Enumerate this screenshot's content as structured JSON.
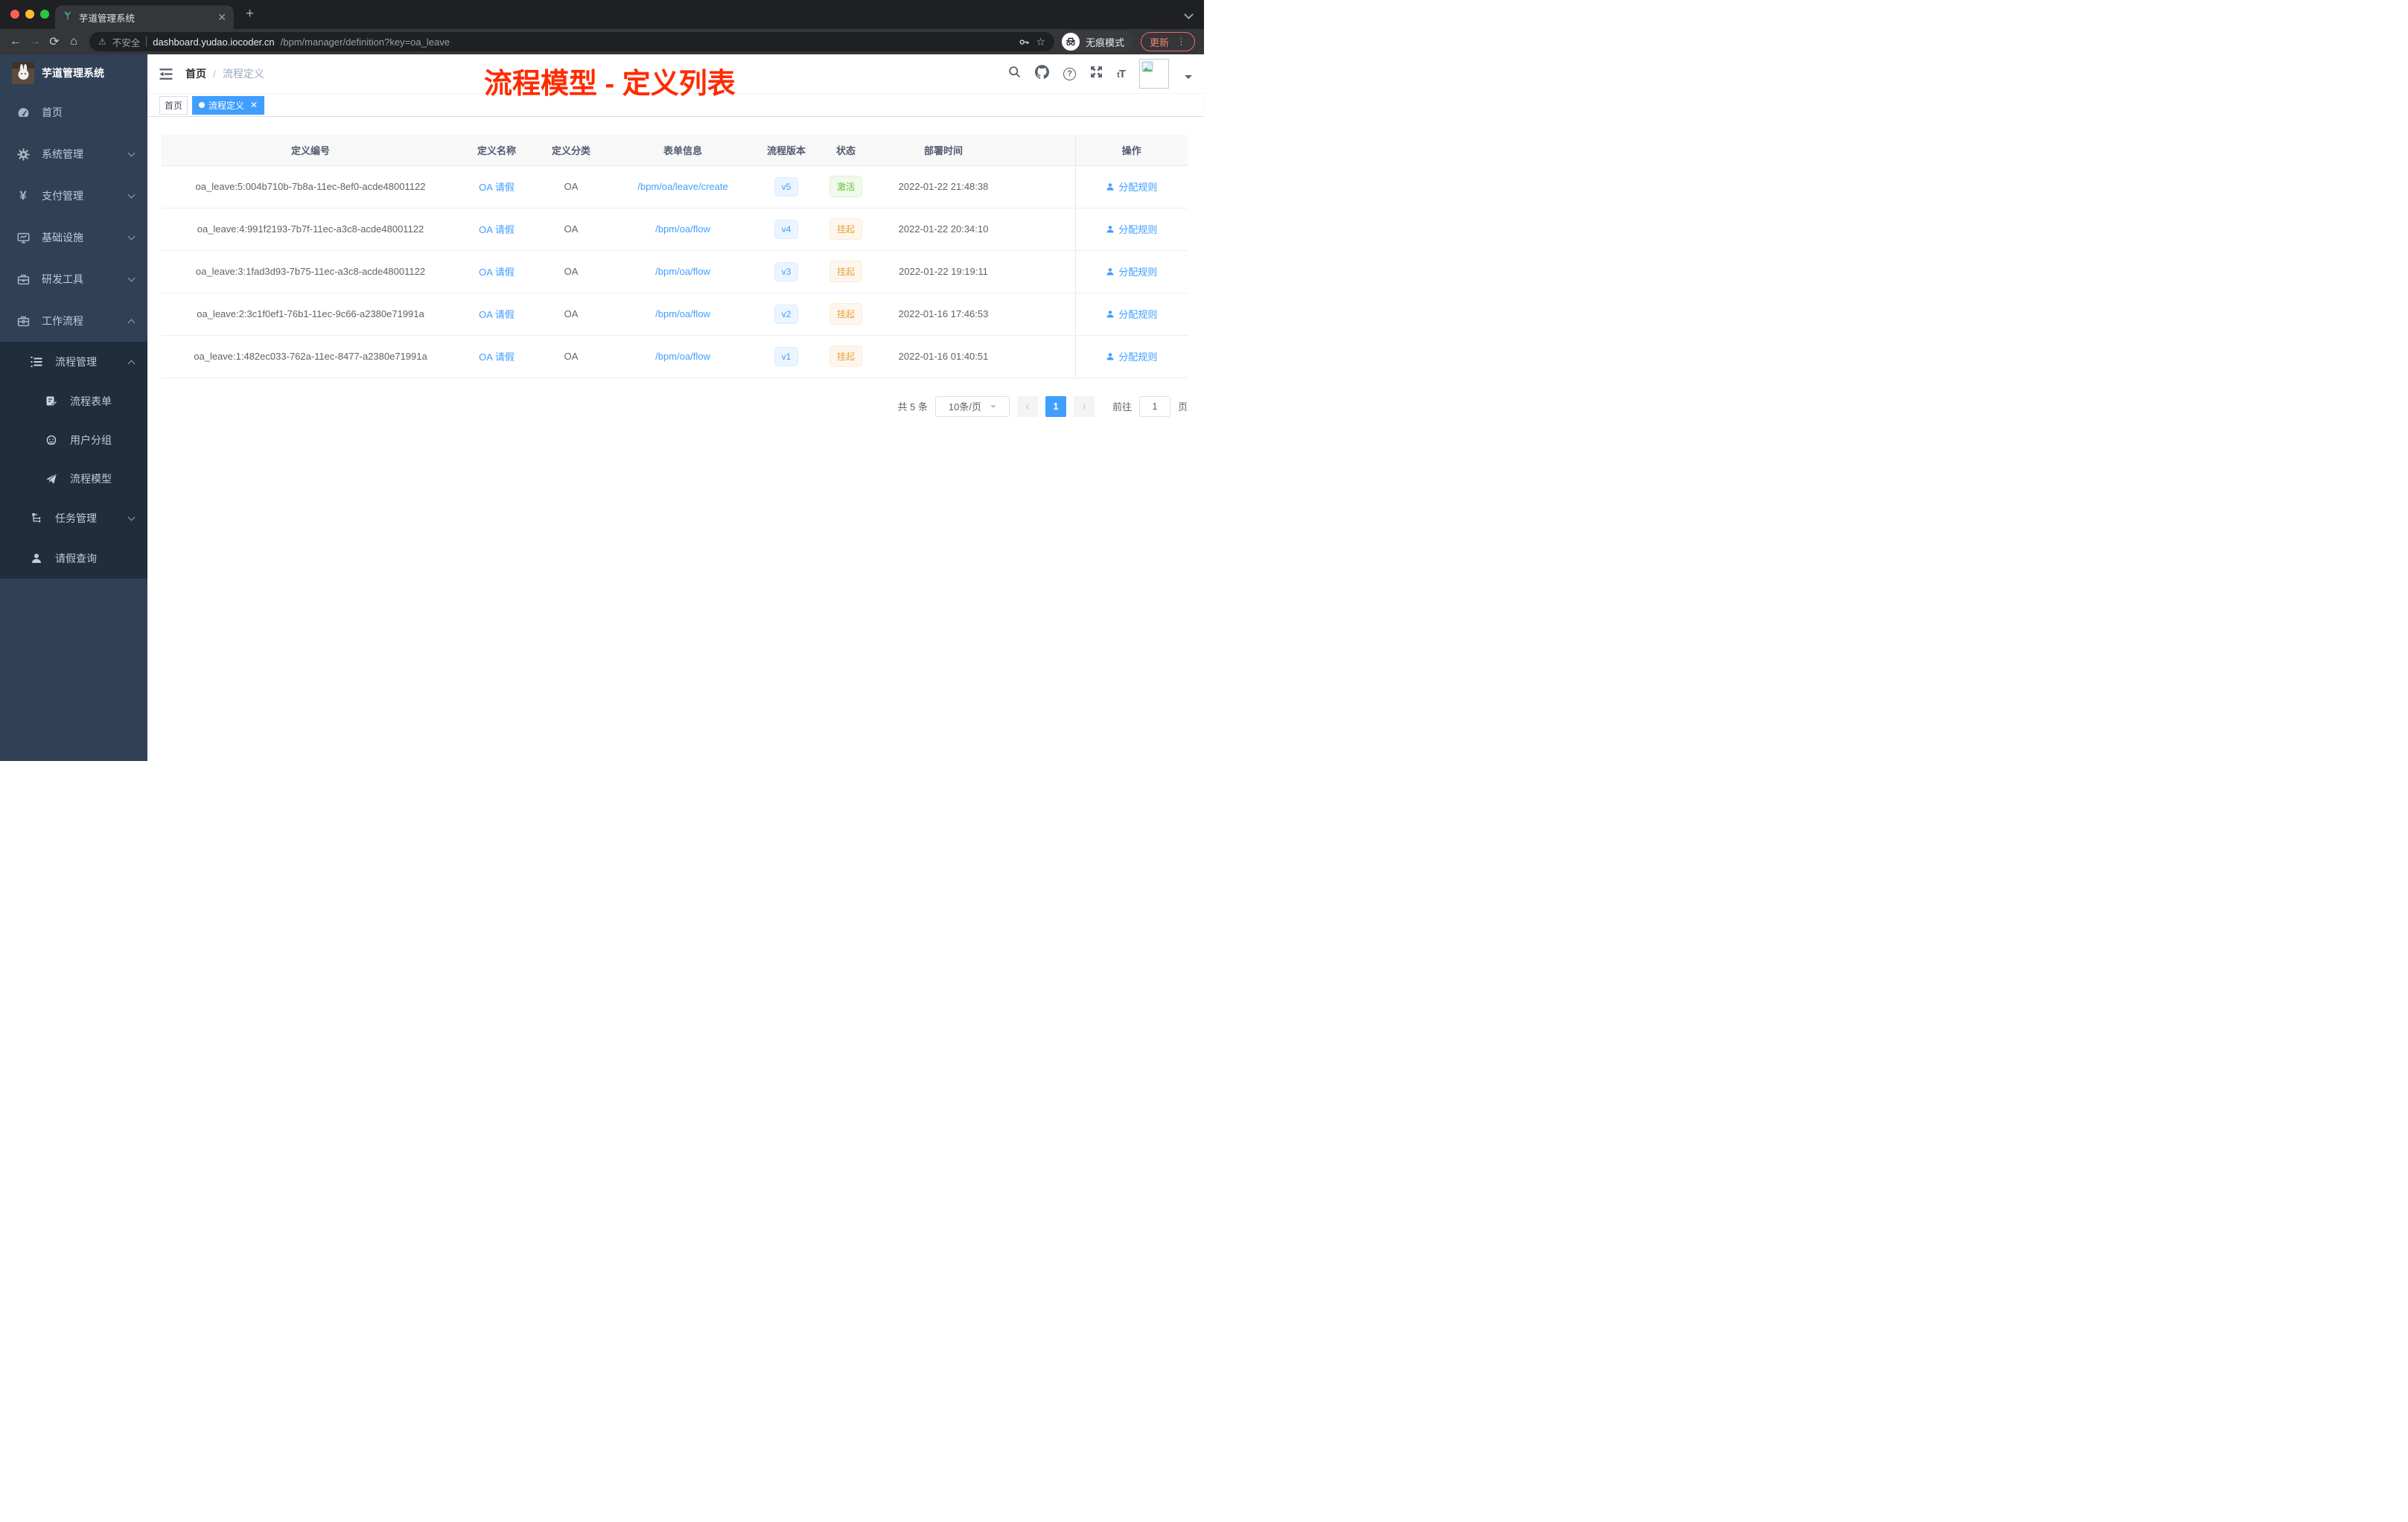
{
  "browser": {
    "tab_title": "芋道管理系统",
    "new_tab": "+",
    "security_label": "不安全",
    "url_host": "dashboard.yudao.iocoder.cn",
    "url_path": "/bpm/manager/definition?key=oa_leave",
    "incognito_label": "无痕模式",
    "update_label": "更新"
  },
  "sidebar": {
    "title": "芋道管理系统",
    "menu": [
      {
        "label": "首页",
        "icon": "dashboard-icon"
      },
      {
        "label": "系统管理",
        "icon": "gear-icon"
      },
      {
        "label": "支付管理",
        "icon": "yen-icon"
      },
      {
        "label": "基础设施",
        "icon": "monitor-icon"
      },
      {
        "label": "研发工具",
        "icon": "toolbox-icon"
      },
      {
        "label": "工作流程",
        "icon": "briefcase-icon",
        "expanded": true
      }
    ],
    "submenu": [
      {
        "label": "流程管理",
        "icon": "list-icon",
        "expanded": true
      },
      {
        "label": "流程表单",
        "icon": "form-icon"
      },
      {
        "label": "用户分组",
        "icon": "robot-icon"
      },
      {
        "label": "流程模型",
        "icon": "paperplane-icon"
      },
      {
        "label": "任务管理",
        "icon": "tree-icon"
      },
      {
        "label": "请假查询",
        "icon": "user-icon"
      }
    ]
  },
  "header": {
    "breadcrumb_home": "首页",
    "breadcrumb_current": "流程定义",
    "annotation": "流程模型 - 定义列表"
  },
  "tags": {
    "home": "首页",
    "active": "流程定义"
  },
  "table": {
    "columns": [
      "定义编号",
      "定义名称",
      "定义分类",
      "表单信息",
      "流程版本",
      "状态",
      "部署时间",
      "操作"
    ],
    "action_label": "分配规则",
    "rows": [
      {
        "id": "oa_leave:5:004b710b-7b8a-11ec-8ef0-acde48001122",
        "name": "OA 请假",
        "category": "OA",
        "form": "/bpm/oa/leave/create",
        "version": "v5",
        "status": "激活",
        "status_type": "success",
        "deployed_at": "2022-01-22 21:48:38"
      },
      {
        "id": "oa_leave:4:991f2193-7b7f-11ec-a3c8-acde48001122",
        "name": "OA 请假",
        "category": "OA",
        "form": "/bpm/oa/flow",
        "version": "v4",
        "status": "挂起",
        "status_type": "warning",
        "deployed_at": "2022-01-22 20:34:10"
      },
      {
        "id": "oa_leave:3:1fad3d93-7b75-11ec-a3c8-acde48001122",
        "name": "OA 请假",
        "category": "OA",
        "form": "/bpm/oa/flow",
        "version": "v3",
        "status": "挂起",
        "status_type": "warning",
        "deployed_at": "2022-01-22 19:19:11"
      },
      {
        "id": "oa_leave:2:3c1f0ef1-76b1-11ec-9c66-a2380e71991a",
        "name": "OA 请假",
        "category": "OA",
        "form": "/bpm/oa/flow",
        "version": "v2",
        "status": "挂起",
        "status_type": "warning",
        "deployed_at": "2022-01-16 17:46:53"
      },
      {
        "id": "oa_leave:1:482ec033-762a-11ec-8477-a2380e71991a",
        "name": "OA 请假",
        "category": "OA",
        "form": "/bpm/oa/flow",
        "version": "v1",
        "status": "挂起",
        "status_type": "warning",
        "deployed_at": "2022-01-16 01:40:51"
      }
    ]
  },
  "pagination": {
    "total": "共 5 条",
    "page_size": "10条/页",
    "page": "1",
    "goto_label": "前往",
    "goto_value": "1",
    "unit_label": "页"
  },
  "colors": {
    "accent": "#409eff",
    "success": "#67c23a",
    "warning": "#e6a23c",
    "annotation_red": "#ff2b00",
    "sidebar_bg": "#304156",
    "submenu_bg": "#1f2d3d"
  }
}
